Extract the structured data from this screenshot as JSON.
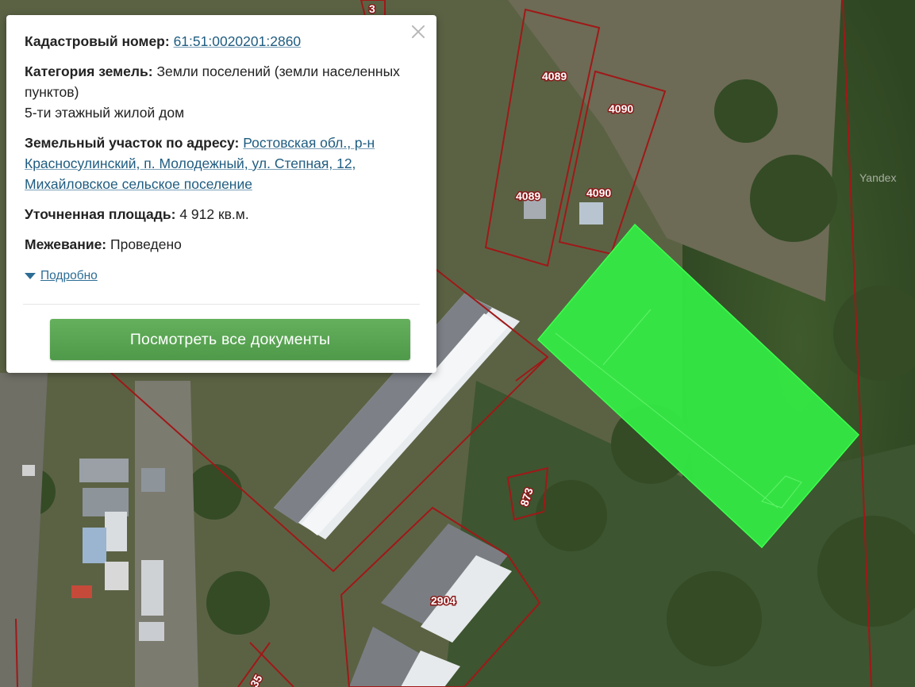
{
  "popup": {
    "cadastral_label": "Кадастровый номер:",
    "cadastral_value": "61:51:0020201:2860",
    "category_label": "Категория земель:",
    "category_value": "Земли поселений (земли населенных пунктов)",
    "category_extra": "5-ти этажный жилой дом",
    "address_label": "Земельный участок по адресу:",
    "address_value": "Ростовская обл., р-н Красносулинский, п. Молодежный, ул. Степная, 12, Михайловское сельское поселение",
    "area_label": "Уточненная площадь:",
    "area_value": "4 912 кв.м.",
    "survey_label": "Межевание:",
    "survey_value": "Проведено",
    "more_link": "Подробно",
    "docs_button": "Посмотреть все документы"
  },
  "map": {
    "plot_labels": [
      "4089",
      "4090",
      "4089",
      "4090",
      "873",
      "2904",
      "35",
      "3"
    ],
    "watermark_yandex": "Yandex",
    "highlight_color": "#33ee44",
    "boundary_color": "#a01818"
  }
}
